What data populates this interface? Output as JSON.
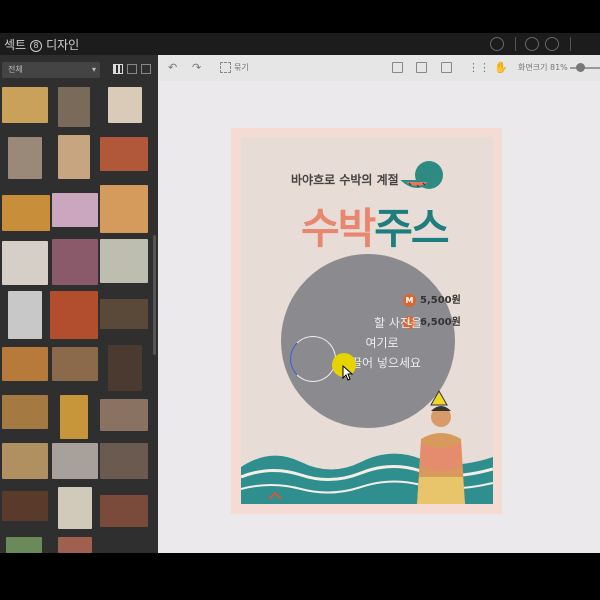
{
  "topbar": {
    "title_prefix": "섹트",
    "title_suffix": "디자인",
    "circle_glyph": "8"
  },
  "panel": {
    "filter": "전체"
  },
  "toolbar": {
    "group_label": "묶기",
    "zoom": "화면크기 81%"
  },
  "poster": {
    "subtitle": "바야흐로 수박의 계절",
    "title_a": "수박",
    "title_b": "주스",
    "prices": [
      {
        "badge": "M",
        "text": "5,500원"
      },
      {
        "badge": "L",
        "text": "6,500원"
      }
    ],
    "drop_line1": "할 사진을",
    "drop_line2": "여기로",
    "drop_line3": "끌어 넣으세요"
  },
  "colors": {
    "accent_red": "#e9866f",
    "accent_teal": "#1f7d7d",
    "badge": "#d9652f",
    "panel": "#2f2f2f"
  },
  "icons": [
    "undo-icon",
    "redo-icon",
    "group-icon",
    "layers-icon",
    "align-icon",
    "grid-icon",
    "hand-icon",
    "apps-icon"
  ]
}
